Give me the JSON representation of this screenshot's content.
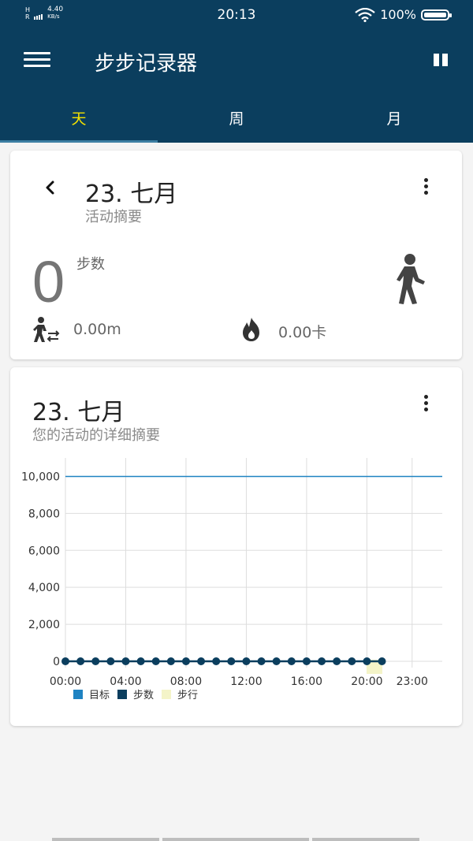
{
  "status": {
    "net_type": "H",
    "net_type2": "R",
    "speed_value": "4.40",
    "speed_unit": "KB/s",
    "time": "20:13",
    "battery": "100%"
  },
  "app": {
    "title": "步步记录器"
  },
  "tabs": [
    {
      "label": "天",
      "active": true
    },
    {
      "label": "周",
      "active": false
    },
    {
      "label": "月",
      "active": false
    }
  ],
  "summary": {
    "date": "23. 七月",
    "subtitle": "活动摘要",
    "steps": "0",
    "steps_label": "步数",
    "distance": "0.00m",
    "calories": "0.00卡"
  },
  "detail": {
    "date": "23. 七月",
    "subtitle": "您的活动的详细摘要"
  },
  "colors": {
    "primary": "#0b3e5e",
    "tab_active": "#f4e200",
    "goal": "#1f83c2",
    "steps": "#0b3e5e",
    "walk": "#f4f4c8"
  },
  "chart_data": {
    "type": "line",
    "x_tick_labels": [
      "00:00",
      "04:00",
      "08:00",
      "12:00",
      "16:00",
      "20:00",
      "23:00"
    ],
    "y_tick_labels": [
      "10,000",
      "8,000",
      "6,000",
      "4,000",
      "2,000",
      "0"
    ],
    "ylim": [
      0,
      11000
    ],
    "xlim": [
      0,
      25
    ],
    "grid": true,
    "legend_position": "bottom-left",
    "series": [
      {
        "name": "目标",
        "kind": "line",
        "x": [
          0,
          25
        ],
        "values": [
          10000,
          10000
        ]
      },
      {
        "name": "步数",
        "kind": "line-markers",
        "x": [
          0,
          1,
          2,
          3,
          4,
          5,
          6,
          7,
          8,
          9,
          10,
          11,
          12,
          13,
          14,
          15,
          16,
          17,
          18,
          19,
          20,
          21
        ],
        "values": [
          0,
          0,
          0,
          0,
          0,
          0,
          0,
          0,
          0,
          0,
          0,
          0,
          0,
          0,
          0,
          0,
          0,
          0,
          0,
          0,
          0,
          0
        ]
      },
      {
        "name": "步行",
        "kind": "bar",
        "x": [
          20
        ],
        "values": [
          0
        ]
      }
    ]
  }
}
